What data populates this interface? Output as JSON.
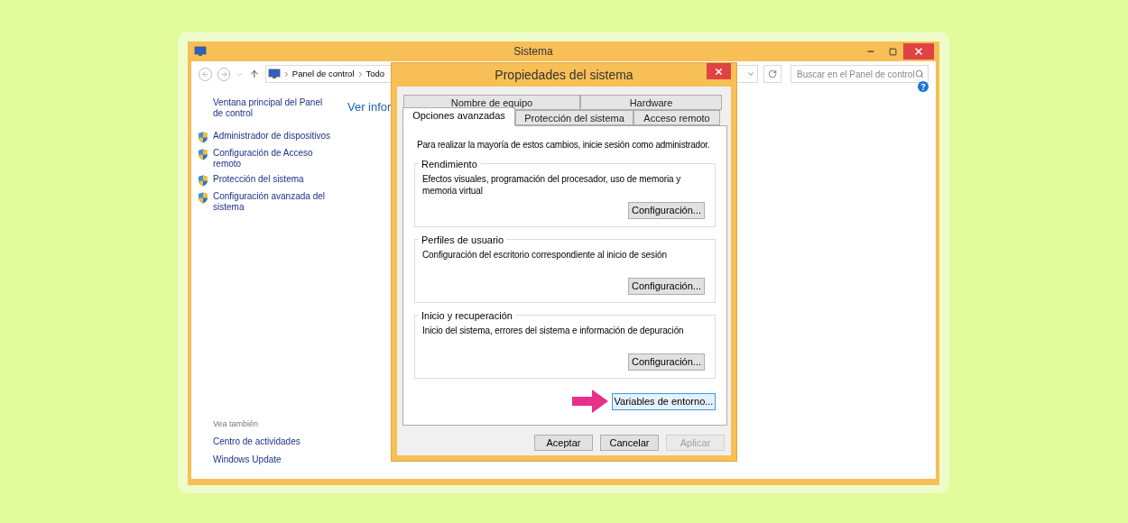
{
  "window": {
    "title": "Sistema"
  },
  "address_bar": {
    "breadcrumb": [
      "Panel de control",
      "Todo"
    ]
  },
  "search": {
    "placeholder": "Buscar en el Panel de control"
  },
  "sidebar": {
    "home_link": "Ventana principal del Panel de control",
    "items": [
      {
        "label": "Administrador de dispositivos"
      },
      {
        "label": "Configuración de Acceso remoto"
      },
      {
        "label": "Protección del sistema"
      },
      {
        "label": "Configuración avanzada del sistema"
      }
    ],
    "see_also_title": "Vea también",
    "see_also": [
      "Centro de actividades",
      "Windows Update"
    ]
  },
  "main": {
    "heading": "Ver infor"
  },
  "dialog": {
    "title": "Propiedades del sistema",
    "tab_rows": [
      [
        {
          "label": "Nombre de equipo",
          "selected": false
        },
        {
          "label": "Hardware",
          "selected": false
        }
      ],
      [
        {
          "label": "Opciones avanzadas",
          "selected": true
        },
        {
          "label": "Protección del sistema",
          "selected": false
        },
        {
          "label": "Acceso remoto",
          "selected": false
        }
      ]
    ],
    "note": "Para realizar la mayoría de estos cambios, inicie sesión como administrador.",
    "groups": [
      {
        "legend": "Rendimiento",
        "description": "Efectos visuales, programación del procesador, uso de memoria y memoria virtual",
        "button": "Configuración..."
      },
      {
        "legend": "Perfiles de usuario",
        "description": "Configuración del escritorio correspondiente al inicio de sesión",
        "button": "Configuración..."
      },
      {
        "legend": "Inicio y recuperación",
        "description": "Inicio del sistema, errores del sistema e información de depuración",
        "button": "Configuración..."
      }
    ],
    "env_button": {
      "label": "Variables de entorno...",
      "focused": true
    },
    "buttons": [
      {
        "label": "Aceptar",
        "disabled": false
      },
      {
        "label": "Cancelar",
        "disabled": false
      },
      {
        "label": "Aplicar",
        "disabled": true
      }
    ]
  }
}
